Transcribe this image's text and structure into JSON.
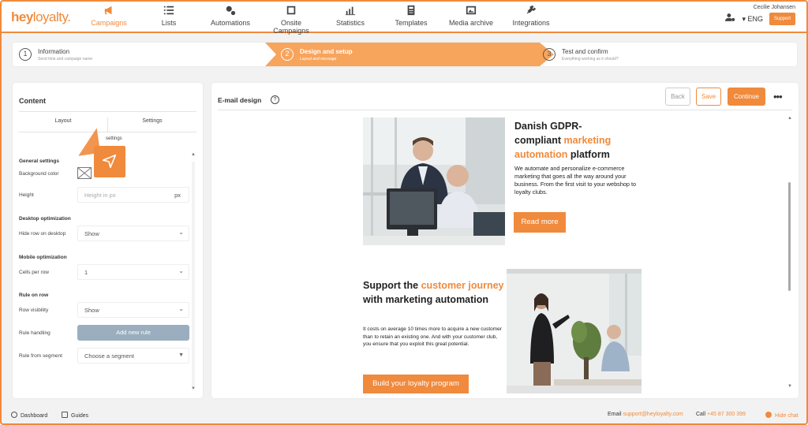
{
  "app": {
    "logo_main": "hey",
    "logo_accent": "loyalty."
  },
  "nav": {
    "items": [
      {
        "label": "Campaigns",
        "icon": "megaphone-icon",
        "active": true
      },
      {
        "label": "Lists",
        "icon": "list-icon",
        "active": false
      },
      {
        "label": "Automations",
        "icon": "automation-icon",
        "active": false
      },
      {
        "label": "Onsite Campaigns",
        "icon": "window-icon",
        "active": false
      },
      {
        "label": "Statistics",
        "icon": "bar-chart-icon",
        "active": false
      },
      {
        "label": "Templates",
        "icon": "template-icon",
        "active": false
      },
      {
        "label": "Media archive",
        "icon": "image-icon",
        "active": false
      },
      {
        "label": "Integrations",
        "icon": "plug-icon",
        "active": false
      }
    ],
    "user_name": "Cecilie Johansen",
    "language": "ENG",
    "support_label": "Support"
  },
  "steps": [
    {
      "number": "1",
      "title": "Information",
      "subtitle": "Send time and campaign name",
      "active": false
    },
    {
      "number": "2",
      "title": "Design and setup",
      "subtitle": "Layout and message",
      "active": true
    },
    {
      "number": "3",
      "title": "Test and confirm",
      "subtitle": "Everything working as it should?",
      "active": false
    }
  ],
  "content_panel": {
    "title": "Content",
    "tabs": [
      "Layout",
      "Settings"
    ],
    "subtab": "settings",
    "general_settings": "General settings",
    "background_color_label": "Background color",
    "height_label": "Height",
    "height_placeholder": "Height in px",
    "height_unit": "px",
    "desktop_optimization": "Desktop optimization",
    "hide_row_label": "Hide row on desktop",
    "hide_row_value": "Show",
    "mobile_optimization": "Mobile optimization",
    "cells_label": "Cells per row",
    "cells_value": "1",
    "rule_on_row": "Rule on row",
    "row_visibility_label": "Row visibility",
    "row_visibility_value": "Show",
    "rule_handling_label": "Rule handling",
    "add_rule_label": "Add new rule",
    "rule_segment_label": "Rule from segment",
    "rule_segment_value": "Choose a segment"
  },
  "email_panel": {
    "title": "E-mail design",
    "help": "?",
    "back_label": "Back",
    "save_label": "Save",
    "continue_label": "Continue",
    "more_label": "•••"
  },
  "email_content": {
    "block1_h_a": "Danish GDPR-",
    "block1_h_b": "compliant ",
    "block1_h_hl": "marketing automation",
    "block1_h_c": " platform",
    "block1_text": "We automate and personalize e-commerce marketing that goes all the way around your business. From the first visit to your webshop to loyalty clubs.",
    "block1_button": "Read more",
    "block2_h_a": "Support the ",
    "block2_h_hl": "customer journey",
    "block2_h_b": " with marketing automation",
    "block2_text": "It costs on average 10 times more to acquire a new customer than to retain an existing one. And with your customer club, you ensure that you exploit this great potential.",
    "block2_button": "Build your loyalty program"
  },
  "footer": {
    "dashboard": "Dashboard",
    "guides": "Guides",
    "email_label": "Email",
    "email_value": "support@heyloyalty.com",
    "call_label": "Call",
    "call_value": "+45 87 300 399",
    "hide_chat": "Hide chat"
  },
  "colors": {
    "accent": "#f08a3c",
    "rule_button": "#9aaebf"
  }
}
